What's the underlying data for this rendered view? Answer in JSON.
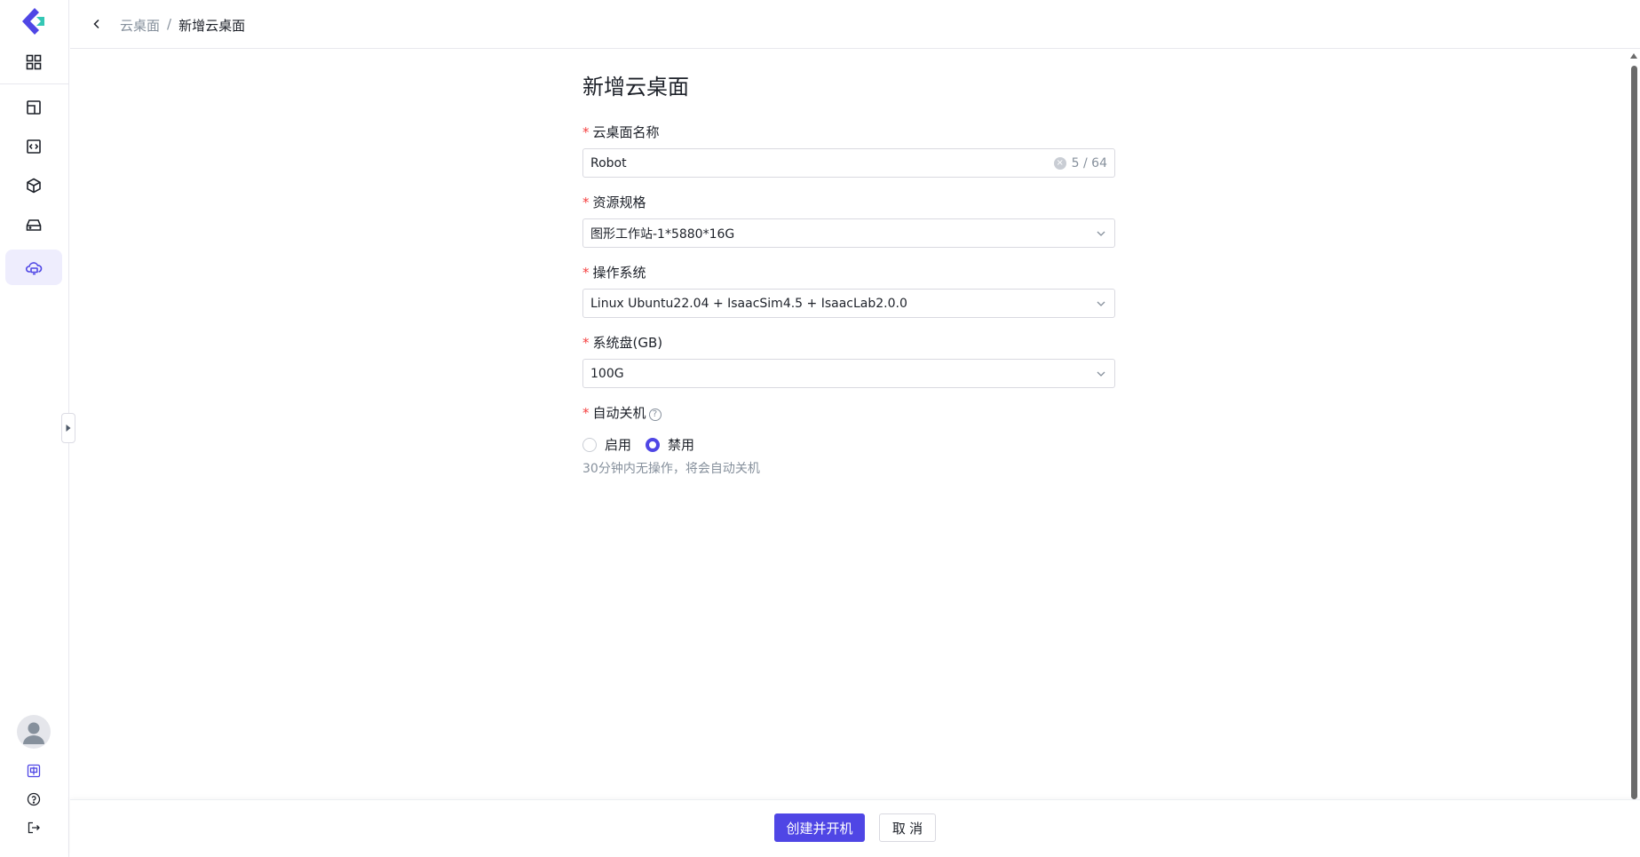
{
  "breadcrumb": {
    "parent": "云桌面",
    "separator": "/",
    "current": "新增云桌面"
  },
  "form": {
    "title": "新增云桌面",
    "name": {
      "label": "云桌面名称",
      "value": "Robot",
      "counter": "5 / 64"
    },
    "spec": {
      "label": "资源规格",
      "value": "图形工作站-1*5880*16G"
    },
    "os": {
      "label": "操作系统",
      "value": "Linux Ubuntu22.04 + IsaacSim4.5 + IsaacLab2.0.0"
    },
    "disk": {
      "label": "系统盘(GB)",
      "value": "100G"
    },
    "auto_shutdown": {
      "label": "自动关机",
      "options": [
        "启用",
        "禁用"
      ],
      "selected": "禁用",
      "hint": "30分钟内无操作，将会自动关机"
    },
    "required_mark": "*"
  },
  "footer": {
    "primary_label": "创建并开机",
    "cancel_label": "取 消"
  },
  "colors": {
    "accent": "#4f46e5",
    "required": "#f53f3f",
    "active_nav_bg": "#eeedfd"
  },
  "sidebar": {
    "icons": [
      "dashboard-grid-icon",
      "layout-icon",
      "code-icon",
      "cube-icon",
      "storage-icon",
      "cloud-desktop-icon"
    ],
    "active": "cloud-desktop-icon",
    "bottom": [
      "language-icon",
      "help-icon",
      "logout-icon"
    ]
  }
}
